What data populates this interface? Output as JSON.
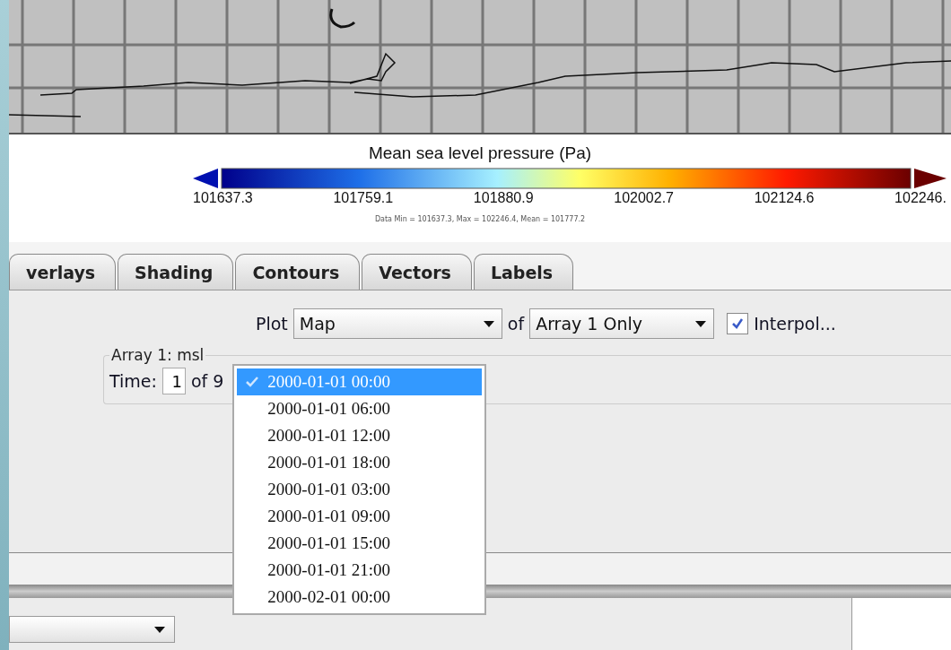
{
  "plot": {
    "title": "Mean sea level pressure (Pa)",
    "scale_labels": [
      "101637.3",
      "101759.1",
      "101880.9",
      "102002.7",
      "102124.6",
      "102246."
    ],
    "stats": "Data Min = 101637.3, Max = 102246.4, Mean = 101777.2"
  },
  "tabs": [
    {
      "label": "verlays",
      "selected": false
    },
    {
      "label": "Shading",
      "selected": false
    },
    {
      "label": "Contours",
      "selected": false
    },
    {
      "label": "Vectors",
      "selected": false
    },
    {
      "label": "Labels",
      "selected": false
    }
  ],
  "controls": {
    "plot_label": "Plot",
    "plot_select": "Map",
    "of_label": "of",
    "array_select": "Array 1 Only",
    "interpolate": {
      "label": "Interpol...",
      "checked": true
    }
  },
  "array_group": {
    "title": "Array 1: msl",
    "time_label": "Time:",
    "time_value": "1",
    "time_count": "of 9",
    "time_options": [
      {
        "label": "2000-01-01 00:00",
        "selected": true
      },
      {
        "label": "2000-01-01 06:00",
        "selected": false
      },
      {
        "label": "2000-01-01 12:00",
        "selected": false
      },
      {
        "label": "2000-01-01 18:00",
        "selected": false
      },
      {
        "label": "2000-01-01 03:00",
        "selected": false
      },
      {
        "label": "2000-01-01 09:00",
        "selected": false
      },
      {
        "label": "2000-01-01 15:00",
        "selected": false
      },
      {
        "label": "2000-01-01 21:00",
        "selected": false
      },
      {
        "label": "2000-02-01 00:00",
        "selected": false
      }
    ]
  }
}
